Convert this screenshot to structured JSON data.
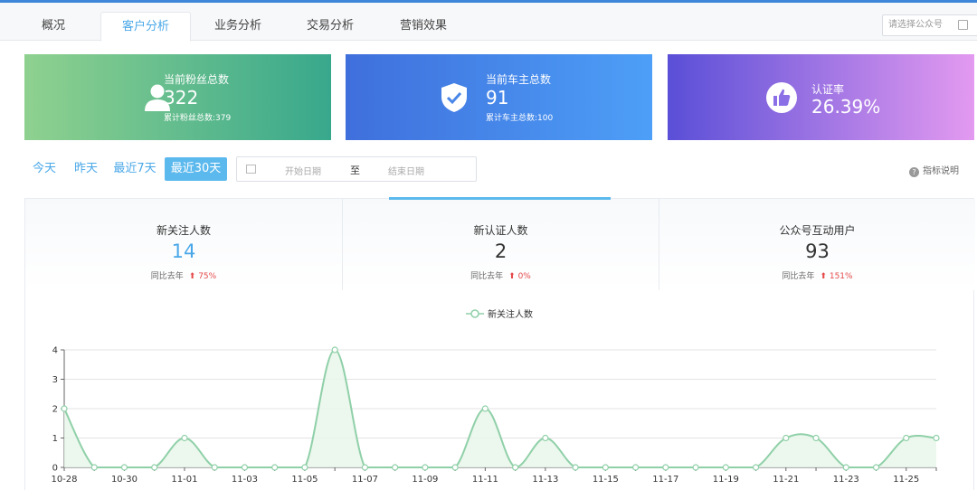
{
  "tabs": [
    {
      "label": "概况",
      "active": false
    },
    {
      "label": "客户分析",
      "active": true
    },
    {
      "label": "业务分析",
      "active": false
    },
    {
      "label": "交易分析",
      "active": false
    },
    {
      "label": "营销效果",
      "active": false
    }
  ],
  "account_select": {
    "placeholder": "请选择公众号",
    "icon": "calendar-icon"
  },
  "cards": [
    {
      "label": "当前粉丝总数",
      "value": "322",
      "sub": "累计粉丝总数:379",
      "icon": "user-icon",
      "gradient": [
        "#8fd18f",
        "#38a88c"
      ]
    },
    {
      "label": "当前车主总数",
      "value": "91",
      "sub": "累计车主总数:100",
      "icon": "shield-check-icon",
      "gradient": [
        "#3f6fdc",
        "#4d9ff7"
      ]
    },
    {
      "label": "认证率",
      "value": "26.39%",
      "sub": "",
      "icon": "thumbs-up-icon",
      "gradient": [
        "#5a4fd7",
        "#e39af0"
      ]
    }
  ],
  "range_buttons": [
    {
      "label": "今天",
      "active": false
    },
    {
      "label": "昨天",
      "active": false
    },
    {
      "label": "最近7天",
      "active": false
    },
    {
      "label": "最近30天",
      "active": true
    }
  ],
  "date_range": {
    "start_placeholder": "开始日期",
    "separator": "至",
    "end_placeholder": "结束日期",
    "icon": "calendar-icon"
  },
  "help": {
    "label": "指标说明",
    "icon": "question-icon"
  },
  "stats": [
    {
      "label": "新关注人数",
      "value": "14",
      "compare_label": "同比去年",
      "change": "75%",
      "value_color": "#4aa8e8"
    },
    {
      "label": "新认证人数",
      "value": "2",
      "compare_label": "同比去年",
      "change": "0%",
      "value_color": "#333333"
    },
    {
      "label": "公众号互动用户",
      "value": "93",
      "compare_label": "同比去年",
      "change": "151%",
      "value_color": "#333333"
    }
  ],
  "colors": {
    "accent": "#4aa8e8",
    "up": "#e54a4a",
    "series": "#8fd0a8"
  },
  "chart_data": {
    "type": "line",
    "smooth": true,
    "area": true,
    "legend": [
      "新关注人数"
    ],
    "legend_position": "top-center",
    "x": [
      "10-28",
      "10-29",
      "10-30",
      "10-31",
      "11-01",
      "11-02",
      "11-03",
      "11-04",
      "11-05",
      "11-06",
      "11-07",
      "11-08",
      "11-09",
      "11-10",
      "11-11",
      "11-12",
      "11-13",
      "11-14",
      "11-15",
      "11-16",
      "11-17",
      "11-18",
      "11-19",
      "11-20",
      "11-21",
      "11-22",
      "11-23",
      "11-24",
      "11-25",
      "11-26"
    ],
    "x_tick_labels": [
      "10-28",
      "10-30",
      "11-01",
      "11-03",
      "11-05",
      "11-07",
      "11-09",
      "11-11",
      "11-13",
      "11-15",
      "11-17",
      "11-19",
      "11-21",
      "11-23",
      "11-25"
    ],
    "series": [
      {
        "name": "新关注人数",
        "values": [
          2,
          0,
          0,
          0,
          1,
          0,
          0,
          0,
          0,
          4,
          0,
          0,
          0,
          0,
          2,
          0,
          1,
          0,
          0,
          0,
          0,
          0,
          0,
          0,
          1,
          1,
          0,
          0,
          1,
          1
        ]
      }
    ],
    "y_ticks": [
      0,
      1,
      2,
      3,
      4
    ],
    "ylim": [
      0,
      4
    ],
    "grid": true
  }
}
